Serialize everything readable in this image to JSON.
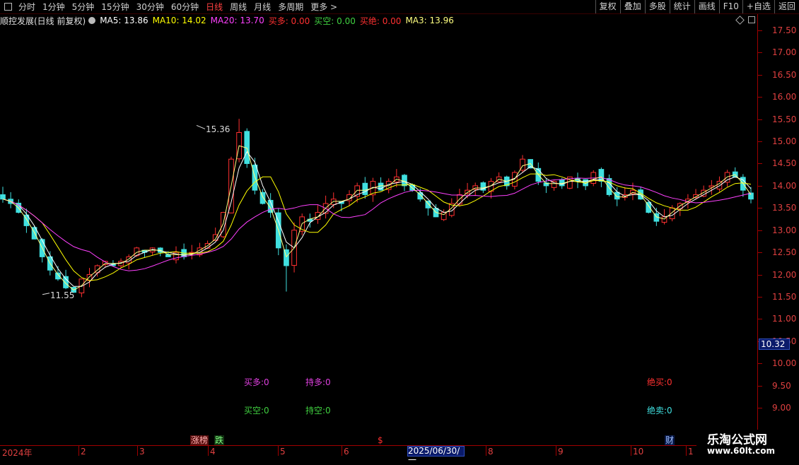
{
  "toolbar": {
    "periods": [
      "分时",
      "1分钟",
      "5分钟",
      "15分钟",
      "30分钟",
      "60分钟",
      "日线",
      "周线",
      "月线",
      "多周期",
      "更多 >"
    ],
    "active_period": "日线",
    "buttons": [
      "复权",
      "叠加",
      "多股",
      "统计",
      "画线",
      "F10",
      "+自选",
      "返回"
    ]
  },
  "info": {
    "title": "顺控发展(日线 前复权)",
    "ma5": "MA5: 13.86",
    "ma10": "MA10: 14.02",
    "ma20": "MA20: 13.70",
    "buy_more": "买多: 0.00",
    "buy_empty": "买空: 0.00",
    "buy_absolute": "买绝: 0.00",
    "ma3": "MA3: 13.96",
    "colors": {
      "ma5": "#ffffff",
      "ma10": "#ffff00",
      "ma20": "#ff40ff",
      "buy_more": "#ff3030",
      "buy_empty": "#40d040",
      "buy_absolute": "#ff3030",
      "ma3": "#ffff80"
    }
  },
  "axis": {
    "labels": [
      "17.50",
      "17.00",
      "16.50",
      "16.00",
      "15.50",
      "15.00",
      "14.50",
      "14.00",
      "13.50",
      "13.00",
      "12.50",
      "12.00",
      "11.50",
      "11.00",
      "10.50",
      "10.00",
      "9.50",
      "9.00"
    ],
    "current_price": "10.32"
  },
  "annotations": {
    "high": "15.36",
    "low": "11.55"
  },
  "signals": {
    "buy_more": "买多:0",
    "hold_more": "持多:0",
    "absolute_sell": "绝买:0",
    "buy_empty": "买空:0",
    "hold_empty": "持空:0",
    "absolute_sell2": "绝卖:0"
  },
  "tags": {
    "limit_up": "涨榜",
    "fall": "跌",
    "dollar": "$",
    "finance": "财"
  },
  "dates": {
    "year": "2024年",
    "months": [
      "2",
      "3",
      "4",
      "5",
      "6",
      "7",
      "8",
      "9",
      "10",
      "1"
    ],
    "cursor": "2025/06/30/一"
  },
  "watermark": {
    "line1": "乐淘公式网",
    "line2": "www.60lt.com"
  },
  "chart_data": {
    "type": "candlestick",
    "ylim": [
      8.8,
      17.8
    ],
    "high": 15.36,
    "low": 11.55,
    "series": [
      {
        "name": "MA5",
        "value": 13.86
      },
      {
        "name": "MA10",
        "value": 14.02
      },
      {
        "name": "MA20",
        "value": 13.7
      },
      {
        "name": "MA3",
        "value": 13.96
      }
    ],
    "close": [
      13.7,
      13.6,
      13.4,
      13.1,
      12.8,
      12.4,
      12.1,
      11.9,
      11.7,
      11.6,
      11.9,
      12.0,
      12.2,
      12.3,
      12.2,
      12.3,
      12.4,
      12.6,
      12.5,
      12.6,
      12.5,
      12.4,
      12.5,
      12.4,
      12.5,
      12.6,
      12.7,
      12.9,
      13.4,
      14.6,
      15.2,
      14.5,
      13.9,
      13.6,
      13.4,
      12.6,
      12.2,
      13.0,
      13.3,
      13.2,
      13.4,
      13.6,
      13.7,
      13.6,
      13.8,
      14.0,
      13.8,
      14.1,
      13.9,
      14.1,
      14.2,
      14.0,
      13.9,
      13.7,
      13.5,
      13.3,
      13.4,
      13.6,
      13.8,
      13.9,
      14.0,
      13.9,
      14.1,
      14.2,
      14.0,
      14.3,
      14.6,
      14.4,
      14.1,
      14.0,
      14.1,
      14.0,
      14.2,
      14.1,
      14.0,
      14.3,
      14.1,
      13.8,
      13.7,
      13.8,
      13.9,
      13.7,
      13.4,
      13.2,
      13.3,
      13.5,
      13.6,
      13.7,
      13.8,
      13.9,
      14.0,
      14.1,
      14.3,
      14.2,
      13.9,
      13.7
    ]
  }
}
